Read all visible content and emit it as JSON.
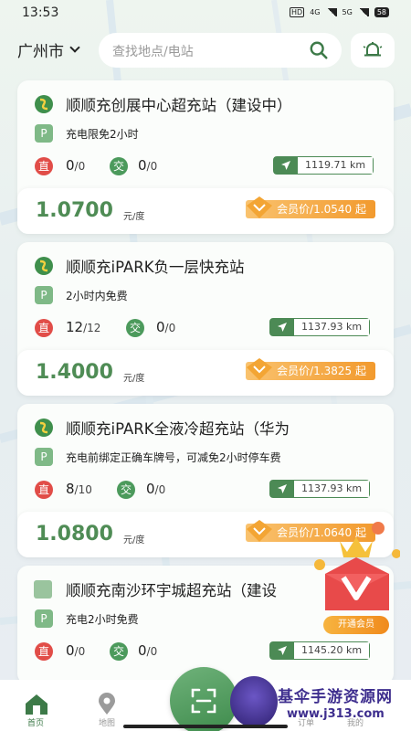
{
  "status_bar": {
    "time": "13:53",
    "network_a": "4G",
    "network_b": "5G",
    "hd": "HD",
    "battery": "58"
  },
  "header": {
    "city": "广州市",
    "search_placeholder": "查找地点/电站"
  },
  "stations": [
    {
      "name": "顺顺充创展中心超充站（建设中）",
      "promo": "充电限免2小时",
      "dc_label": "直",
      "dc_available": "0",
      "dc_total": "/0",
      "ac_label": "交",
      "ac_available": "0",
      "ac_total": "/0",
      "distance": "1119.71 km",
      "price": "1.0700",
      "unit": "元/度",
      "member_price": "会员价/1.0540 起",
      "parking_label": "P"
    },
    {
      "name": "顺顺充iPARK负一层快充站",
      "promo": "2小时内免费",
      "dc_label": "直",
      "dc_available": "12",
      "dc_total": "/12",
      "ac_label": "交",
      "ac_available": "0",
      "ac_total": "/0",
      "distance": "1137.93 km",
      "price": "1.4000",
      "unit": "元/度",
      "member_price": "会员价/1.3825 起",
      "parking_label": "P"
    },
    {
      "name": "顺顺充iPARK全液冷超充站（华为",
      "promo": "充电前绑定正确车牌号，可减免2小时停车费",
      "dc_label": "直",
      "dc_available": "8",
      "dc_total": "/10",
      "ac_label": "交",
      "ac_available": "0",
      "ac_total": "/0",
      "distance": "1137.93 km",
      "price": "1.0800",
      "unit": "元/度",
      "member_price": "会员价/1.0640 起",
      "parking_label": "P"
    },
    {
      "name": "顺顺充南沙环宇城超充站（建设",
      "promo": "充电2小时免费",
      "dc_label": "直",
      "dc_available": "0",
      "dc_total": "/0",
      "ac_label": "交",
      "ac_available": "0",
      "ac_total": "/0",
      "distance": "1145.20 km",
      "parking_label": "P"
    }
  ],
  "vip_promo": {
    "button": "开通会员"
  },
  "bottom_nav": {
    "home": "首页",
    "map": "地图",
    "orders": "订单",
    "mine": "我的"
  },
  "watermark": {
    "title": "基伞手游资源网",
    "url": "www.j313.com"
  },
  "colors": {
    "brand_green": "#4f8c55",
    "dc_red": "#e14d48",
    "ac_green": "#4c9a5c",
    "member_orange": "#f29a2e"
  }
}
